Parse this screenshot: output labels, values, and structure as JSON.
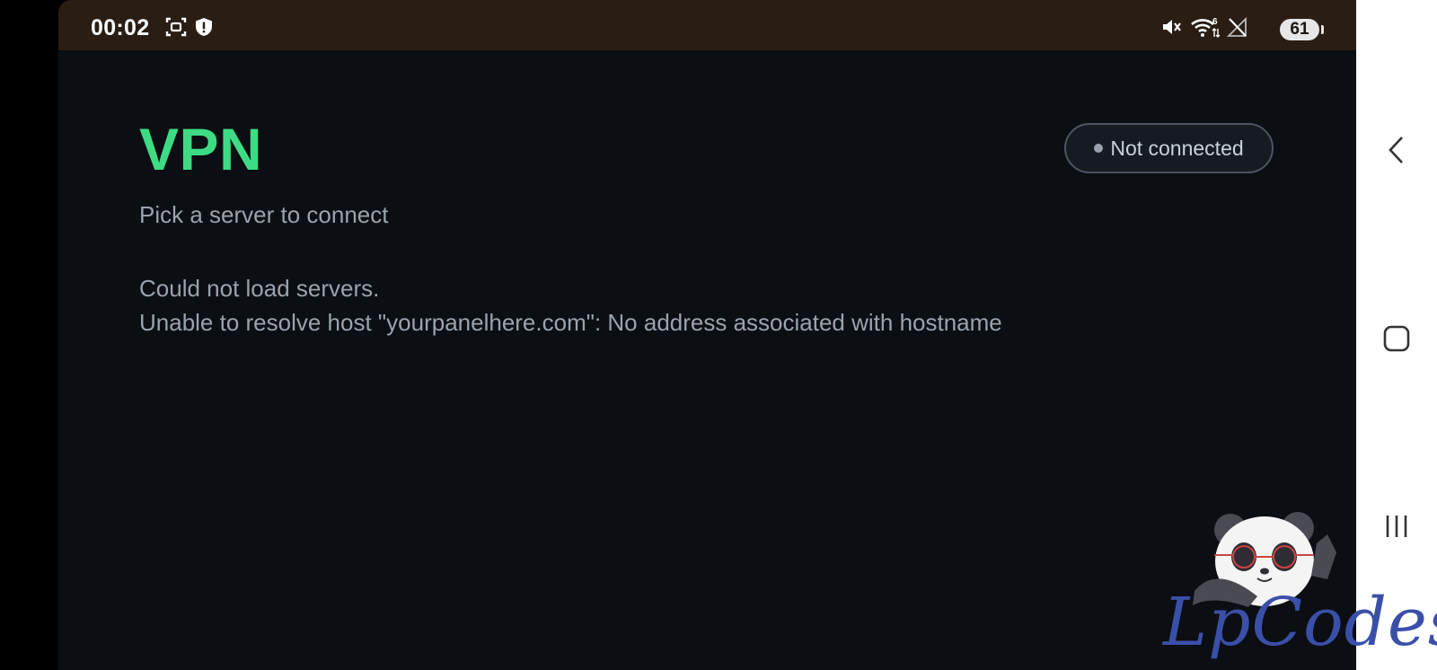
{
  "status_bar": {
    "time": "00:02",
    "battery": "61",
    "icons": [
      "screen-record-icon",
      "shield-alert-icon",
      "mute-icon",
      "wifi-icon",
      "no-signal-icon",
      "battery-icon"
    ]
  },
  "app": {
    "title": "VPN",
    "connection_status": "Not connected",
    "subtitle": "Pick a server to connect",
    "error_line1": "Could not load servers.",
    "error_line2": "Unable to resolve host \"yourpanelhere.com\": No address associated with hostname"
  },
  "navigation": {
    "buttons": [
      "back-icon",
      "home-icon",
      "recents-icon"
    ]
  },
  "watermark": {
    "text": "LpCodes"
  },
  "colors": {
    "accent": "#3ddc84",
    "background": "#0b0e13",
    "statusbar": "#2a1d14",
    "text_muted": "#9aa3ad"
  }
}
